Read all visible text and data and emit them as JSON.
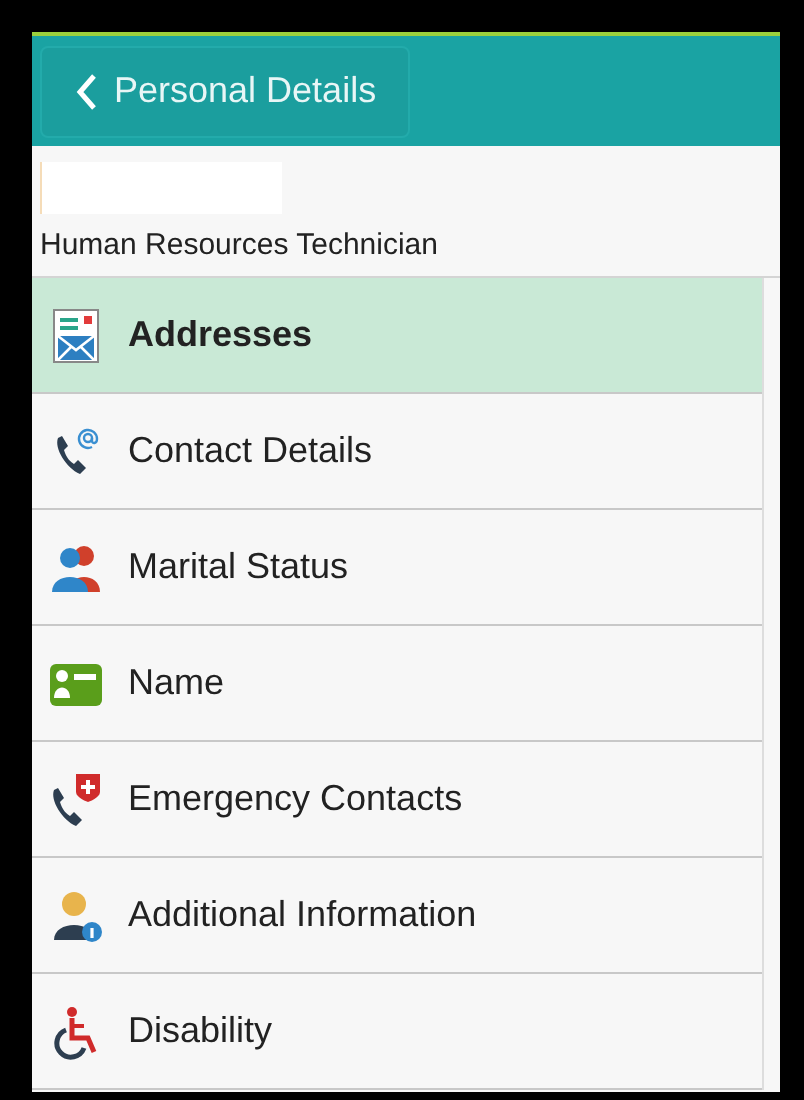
{
  "header": {
    "back_label": "Personal Details"
  },
  "profile": {
    "job_title": "Human Resources Technician"
  },
  "menu": [
    {
      "kind": "address",
      "label": "Addresses",
      "selected": true
    },
    {
      "kind": "contact",
      "label": "Contact Details",
      "selected": false
    },
    {
      "kind": "marital",
      "label": "Marital Status",
      "selected": false
    },
    {
      "kind": "name",
      "label": "Name",
      "selected": false
    },
    {
      "kind": "emergency",
      "label": "Emergency Contacts",
      "selected": false
    },
    {
      "kind": "info",
      "label": "Additional Information",
      "selected": false
    },
    {
      "kind": "disability",
      "label": "Disability",
      "selected": false
    }
  ]
}
